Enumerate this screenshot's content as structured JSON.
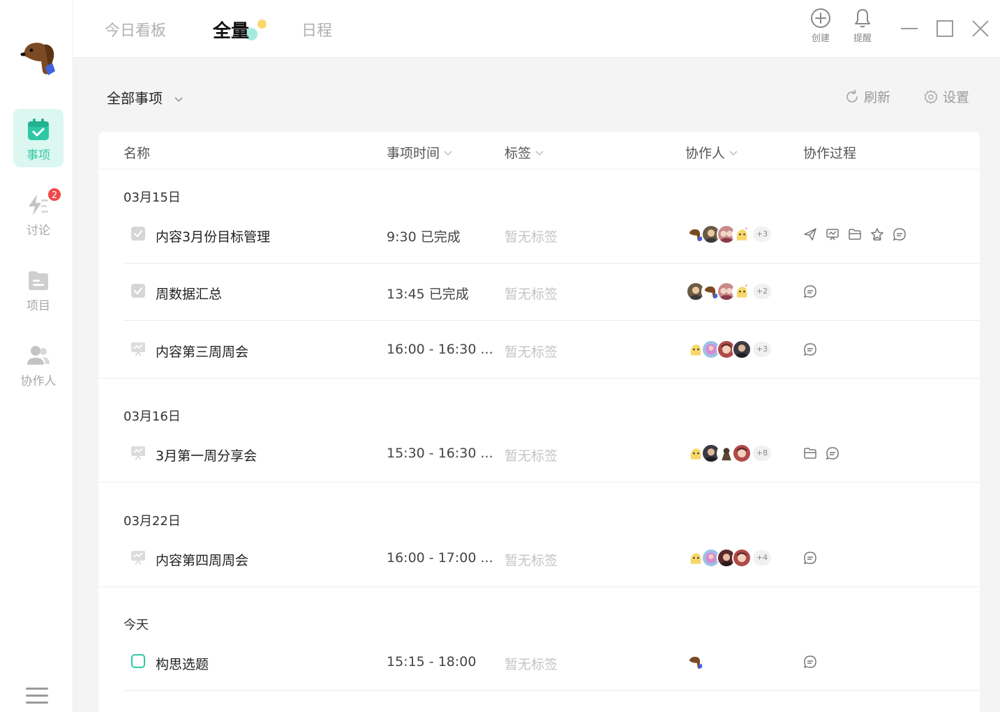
{
  "nav": {
    "items": [
      {
        "label": "事项",
        "icon": "calendar-check-icon",
        "active": true,
        "badge": ""
      },
      {
        "label": "讨论",
        "icon": "lightning-list-icon",
        "active": false,
        "badge": "2"
      },
      {
        "label": "项目",
        "icon": "folder-icon",
        "active": false,
        "badge": ""
      },
      {
        "label": "协作人",
        "icon": "people-icon",
        "active": false,
        "badge": ""
      }
    ]
  },
  "header": {
    "tabs": [
      {
        "label": "今日看板",
        "active": false
      },
      {
        "label": "全量",
        "active": true
      },
      {
        "label": "日程",
        "active": false
      }
    ],
    "create_label": "创建",
    "remind_label": "提醒"
  },
  "toolbar": {
    "filter_label": "全部事项",
    "refresh_label": "刷新",
    "settings_label": "设置"
  },
  "table": {
    "columns": {
      "name": "名称",
      "time": "事项时间",
      "tags": "标签",
      "collaborators": "协作人",
      "process": "协作过程"
    },
    "groups": [
      {
        "date": "03月15日",
        "rows": [
          {
            "name": "内容3月份目标管理",
            "time": "9:30 已完成",
            "tag": "暂无标签",
            "more": "+3",
            "check": "done"
          },
          {
            "name": "周数据汇总",
            "time": "13:45 已完成",
            "tag": "暂无标签",
            "more": "+2",
            "check": "done"
          },
          {
            "name": "内容第三周周会",
            "time": "16:00 - 16:30 ...",
            "tag": "暂无标签",
            "more": "+3",
            "check": "meeting"
          }
        ]
      },
      {
        "date": "03月16日",
        "rows": [
          {
            "name": "3月第一周分享会",
            "time": "15:30 - 16:30 ...",
            "tag": "暂无标签",
            "more": "+8",
            "check": "meeting"
          }
        ]
      },
      {
        "date": "03月22日",
        "rows": [
          {
            "name": "内容第四周周会",
            "time": "16:00 - 17:00 ...",
            "tag": "暂无标签",
            "more": "+4",
            "check": "meeting"
          }
        ]
      },
      {
        "date": "今天",
        "rows": [
          {
            "name": "构思选题",
            "time": "15:15 - 18:00",
            "tag": "暂无标签",
            "more": "",
            "check": "todo"
          }
        ]
      }
    ]
  },
  "colors": {
    "accent": "#2fc8a4",
    "badge": "#f04848"
  }
}
